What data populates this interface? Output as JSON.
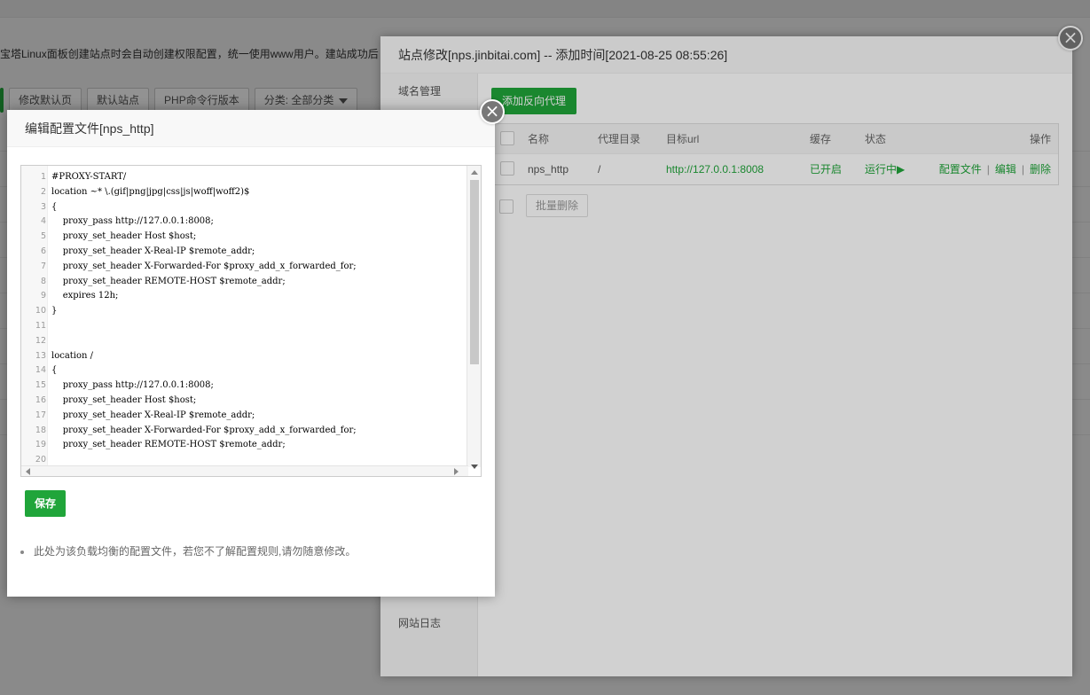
{
  "background": {
    "notice": "宝塔Linux面板创建站点时会自动创建权限配置，统一使用www用户。建站成功后",
    "toolbar": [
      "修改默认页",
      "默认站点",
      "PHP命令行版本",
      "分类: 全部分类"
    ]
  },
  "site_window": {
    "title": "站点修改[nps.jinbitai.com] -- 添加时间[2021-08-25 08:55:26]",
    "sidebar": [
      "域名管理",
      "网站日志"
    ],
    "add_proxy_label": "添加反向代理",
    "table": {
      "headers": [
        "名称",
        "代理目录",
        "目标url",
        "缓存",
        "状态",
        "操作"
      ],
      "rows": [
        {
          "name": "nps_http",
          "dir": "/",
          "url": "http://127.0.0.1:8008",
          "cache": "已开启",
          "status": "运行中▶",
          "actions": [
            "配置文件",
            "编辑",
            "删除"
          ],
          "separators": [
            "|",
            "|"
          ]
        }
      ]
    },
    "batch_delete_label": "批量删除"
  },
  "editor_dialog": {
    "title": "编辑配置文件[nps_http]",
    "lines": [
      {
        "n": "1",
        "t": "#PROXY-START/"
      },
      {
        "n": "2",
        "t": "location ~* \\.(gif|png|jpg|css|js|woff|woff2)$"
      },
      {
        "n": "3",
        "t": "{"
      },
      {
        "n": "4",
        "t": "    proxy_pass http://127.0.0.1:8008;"
      },
      {
        "n": "5",
        "t": "    proxy_set_header Host $host;"
      },
      {
        "n": "6",
        "t": "    proxy_set_header X-Real-IP $remote_addr;"
      },
      {
        "n": "7",
        "t": "    proxy_set_header X-Forwarded-For $proxy_add_x_forwarded_for;"
      },
      {
        "n": "8",
        "t": "    proxy_set_header REMOTE-HOST $remote_addr;"
      },
      {
        "n": "9",
        "t": "    expires 12h;"
      },
      {
        "n": "10",
        "t": "}"
      },
      {
        "n": "11",
        "t": ""
      },
      {
        "n": "12",
        "t": ""
      },
      {
        "n": "13",
        "t": "location /"
      },
      {
        "n": "14",
        "t": "{"
      },
      {
        "n": "15",
        "t": "    proxy_pass http://127.0.0.1:8008;"
      },
      {
        "n": "16",
        "t": "    proxy_set_header Host $host;"
      },
      {
        "n": "17",
        "t": "    proxy_set_header X-Real-IP $remote_addr;"
      },
      {
        "n": "18",
        "t": "    proxy_set_header X-Forwarded-For $proxy_add_x_forwarded_for;"
      },
      {
        "n": "19",
        "t": "    proxy_set_header REMOTE-HOST $remote_addr;"
      },
      {
        "n": "20",
        "t": ""
      }
    ],
    "save_label": "保存",
    "tip": "此处为该负载均衡的配置文件，若您不了解配置规则,请勿随意修改。"
  },
  "icons": {
    "close": "×"
  },
  "colors": {
    "accent": "#20a53a"
  }
}
